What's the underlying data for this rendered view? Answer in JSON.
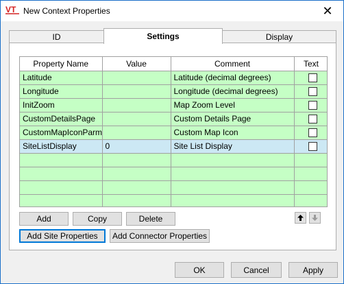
{
  "window": {
    "title": "New Context Properties",
    "logo_text": "VT",
    "close_glyph": "✕"
  },
  "tabs": [
    {
      "label": "ID",
      "active": false
    },
    {
      "label": "Settings",
      "active": true
    },
    {
      "label": "Display",
      "active": false
    }
  ],
  "grid": {
    "columns": [
      "Property Name",
      "Value",
      "Comment",
      "Text"
    ],
    "rows": [
      {
        "name": "Latitude",
        "value": "",
        "comment": "Latitude (decimal degrees)",
        "text": false,
        "selected": false
      },
      {
        "name": "Longitude",
        "value": "",
        "comment": "Longitude (decimal degrees)",
        "text": false,
        "selected": false
      },
      {
        "name": "InitZoom",
        "value": "",
        "comment": "Map Zoom Level",
        "text": false,
        "selected": false
      },
      {
        "name": "CustomDetailsPage",
        "value": "",
        "comment": "Custom Details Page",
        "text": false,
        "selected": false
      },
      {
        "name": "CustomMapIconParm",
        "value": "",
        "comment": "Custom Map Icon",
        "text": false,
        "selected": false
      },
      {
        "name": "SiteListDisplay",
        "value": "0",
        "comment": "Site List Display",
        "text": false,
        "selected": true
      }
    ],
    "empty_rows": 4,
    "row_color": "#c5ffc5",
    "selected_color": "#cce8f4"
  },
  "buttons": {
    "add": "Add",
    "copy": "Copy",
    "delete": "Delete",
    "add_site_properties": "Add Site Properties",
    "add_connector_properties": "Add Connector Properties",
    "move_up_icon": "arrow-up-icon",
    "move_down_icon": "arrow-down-icon"
  },
  "dialog_buttons": {
    "ok": "OK",
    "cancel": "Cancel",
    "apply": "Apply"
  }
}
